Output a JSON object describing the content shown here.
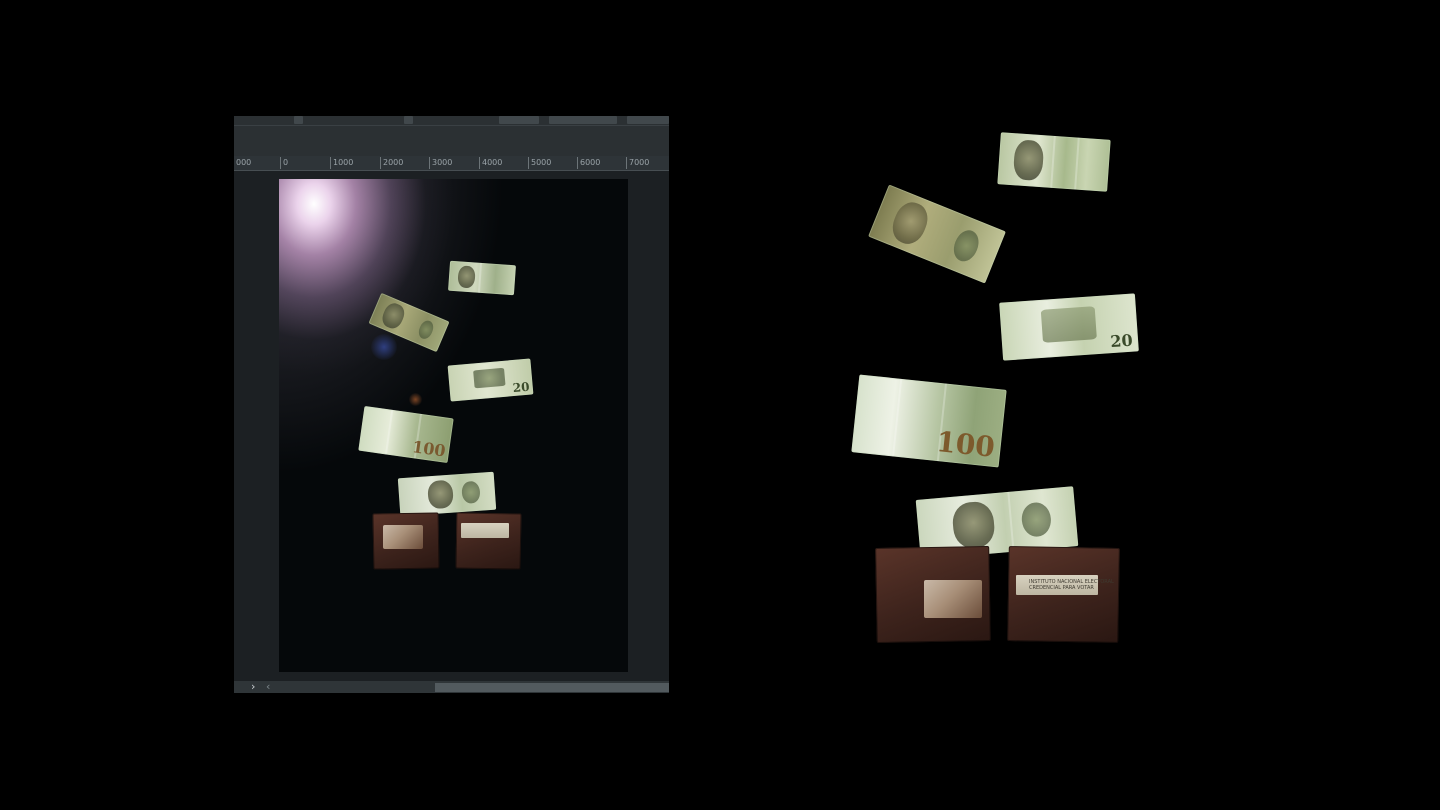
{
  "editor": {
    "ruler_ticks": [
      "000",
      "0",
      "1000",
      "2000",
      "3000",
      "4000",
      "5000",
      "6000",
      "7000"
    ]
  },
  "bills": {
    "small": [
      "20",
      "100"
    ],
    "large": [
      "20",
      "100"
    ]
  },
  "wallet_card": {
    "line1": "INSTITUTO NACIONAL ELECTORAL",
    "line2": "CREDENCIAL PARA VOTAR"
  },
  "colors": {
    "background": "#000000",
    "editor_panel": "#1f2325",
    "bill_green": "#b9c9a6",
    "wallet_brown": "#4a2b22",
    "glow": "#f3dcf0"
  }
}
